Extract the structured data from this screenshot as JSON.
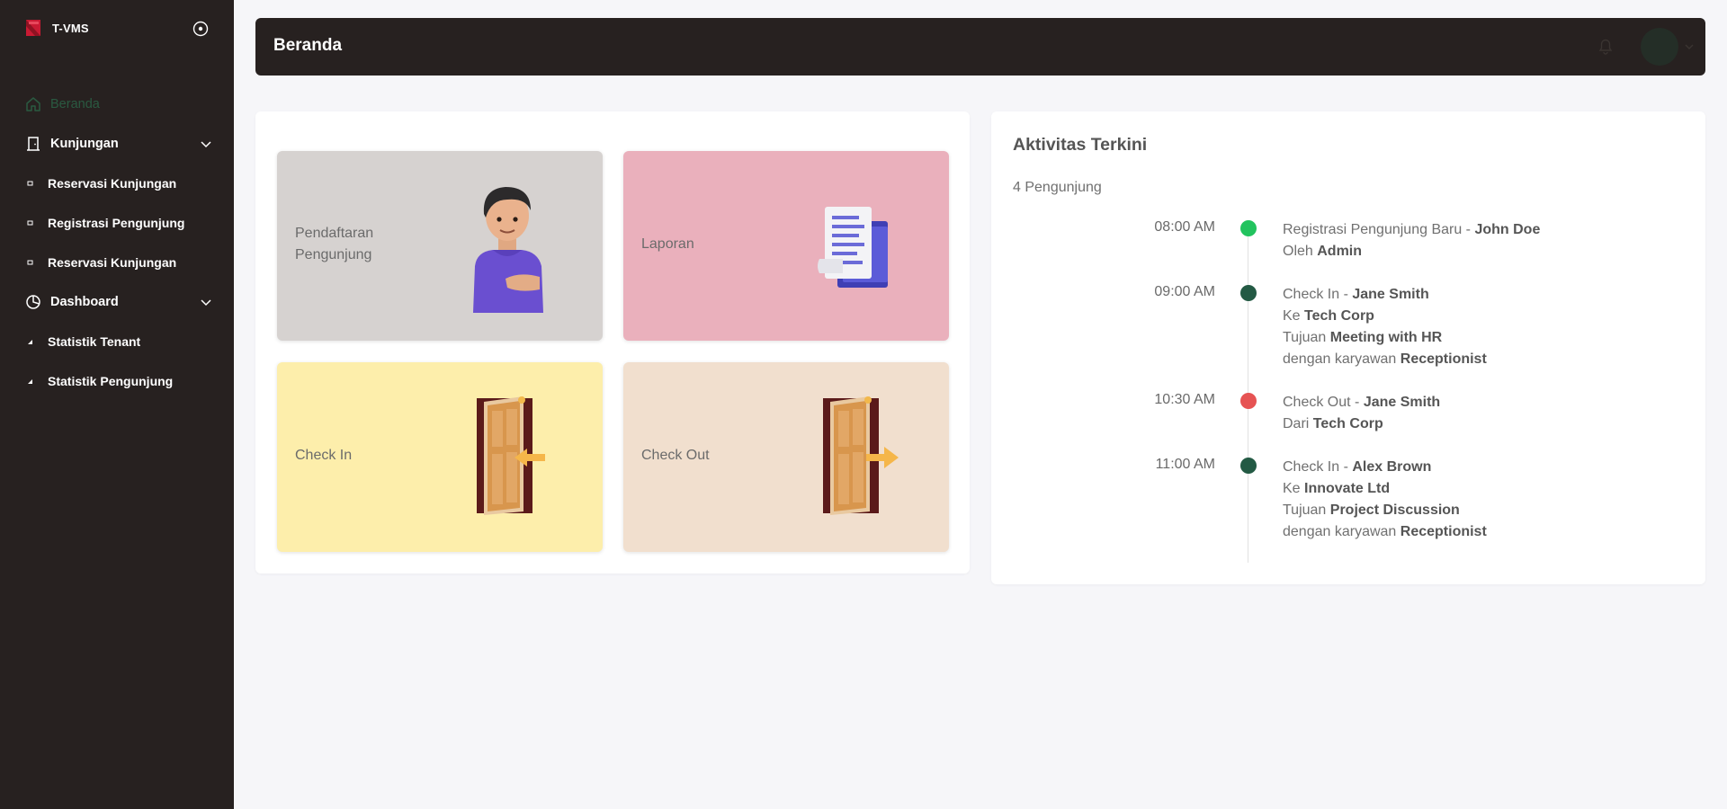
{
  "app": {
    "name": "T-VMS",
    "logo_color": "#d61f3a"
  },
  "sidebar": {
    "background": "#272120",
    "active_color": "#2a5a41",
    "items": [
      {
        "label": "Beranda",
        "icon": "home-icon",
        "active": true
      },
      {
        "label": "Kunjungan",
        "icon": "door-icon",
        "expandable": true
      },
      {
        "label": "Reservasi Kunjungan",
        "sub": true
      },
      {
        "label": "Registrasi Pengunjung",
        "sub": true
      },
      {
        "label": "Reservasi Kunjungan",
        "sub": true
      },
      {
        "label": "Dashboard",
        "icon": "pie-chart-icon",
        "expandable": true
      },
      {
        "label": "Statistik Tenant",
        "sub": true
      },
      {
        "label": "Statistik Pengunjung",
        "sub": true
      }
    ]
  },
  "header": {
    "title": "Beranda",
    "bell_icon": "bell-icon",
    "avatar_icon": "avatar"
  },
  "menu": {
    "tiles": [
      {
        "label": "Pendaftaran Pengunjung",
        "color": "#d6d2d0",
        "icon": "person-illustration"
      },
      {
        "label": "Laporan",
        "color": "#eab0bc",
        "icon": "document-illustration"
      },
      {
        "label": "Check In",
        "color": "#fdeeab",
        "icon": "door-enter-illustration"
      },
      {
        "label": "Check Out",
        "color": "#f1dfce",
        "icon": "door-exit-illustration"
      }
    ]
  },
  "activity": {
    "title": "Aktivitas Terkini",
    "count": "4 Pengunjung",
    "items": [
      {
        "time": "08:00 AM",
        "color": "#22c35e",
        "lines": [
          {
            "pre": "Registrasi Pengunjung Baru - ",
            "bold": "John Doe"
          },
          {
            "pre": "Oleh ",
            "bold": "Admin"
          }
        ]
      },
      {
        "time": "09:00 AM",
        "color": "#235a44",
        "lines": [
          {
            "pre": "Check In - ",
            "bold": "Jane Smith"
          },
          {
            "pre": "Ke ",
            "bold": "Tech Corp"
          },
          {
            "pre": "Tujuan ",
            "bold": "Meeting with HR"
          },
          {
            "pre": "dengan karyawan ",
            "bold": "Receptionist"
          }
        ]
      },
      {
        "time": "10:30 AM",
        "color": "#e65353",
        "lines": [
          {
            "pre": "Check Out - ",
            "bold": "Jane Smith"
          },
          {
            "pre": "Dari ",
            "bold": "Tech Corp"
          }
        ]
      },
      {
        "time": "11:00 AM",
        "color": "#235a44",
        "lines": [
          {
            "pre": "Check In - ",
            "bold": "Alex Brown"
          },
          {
            "pre": "Ke ",
            "bold": "Innovate Ltd"
          },
          {
            "pre": "Tujuan ",
            "bold": "Project Discussion"
          },
          {
            "pre": "dengan karyawan ",
            "bold": "Receptionist"
          }
        ]
      }
    ]
  }
}
